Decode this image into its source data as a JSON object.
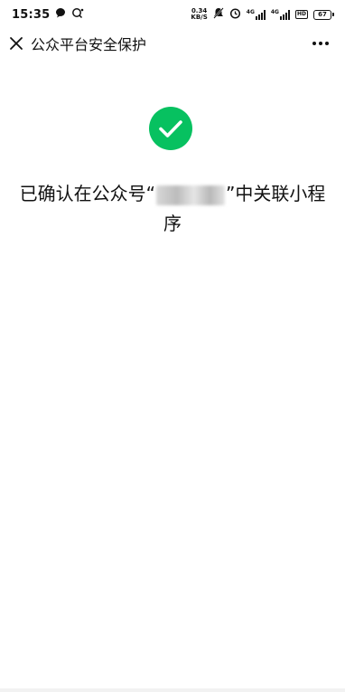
{
  "status_bar": {
    "time": "15:35",
    "net_speed_value": "0.34",
    "net_speed_unit": "KB/S",
    "sig1_label": "4G",
    "sig2_label": "4G",
    "wifi_label": "HD",
    "battery": "67"
  },
  "header": {
    "title": "公众平台安全保护",
    "close_icon": "close-icon",
    "more_icon": "more-icon"
  },
  "content": {
    "success_color": "#07C160",
    "message_prefix": "已确认在公众号“",
    "message_suffix": "”中关联小程序"
  }
}
